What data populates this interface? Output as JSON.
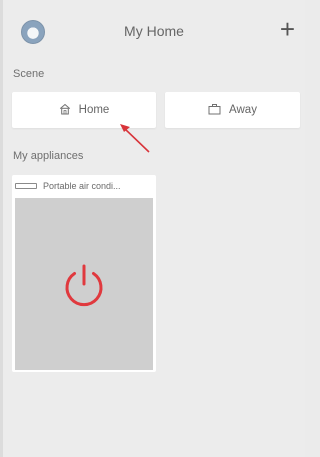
{
  "header": {
    "title": "My Home",
    "add_label": "+"
  },
  "scene": {
    "section_label": "Scene",
    "items": [
      {
        "label": "Home",
        "icon": "home-icon"
      },
      {
        "label": "Away",
        "icon": "away-icon"
      }
    ]
  },
  "appliances": {
    "section_label": "My appliances",
    "items": [
      {
        "name": "Portable air condi...",
        "icon": "air-conditioner-icon",
        "power_icon": "power-icon"
      }
    ]
  },
  "colors": {
    "power": "#e0393e",
    "annotation_arrow": "#d8343a"
  }
}
